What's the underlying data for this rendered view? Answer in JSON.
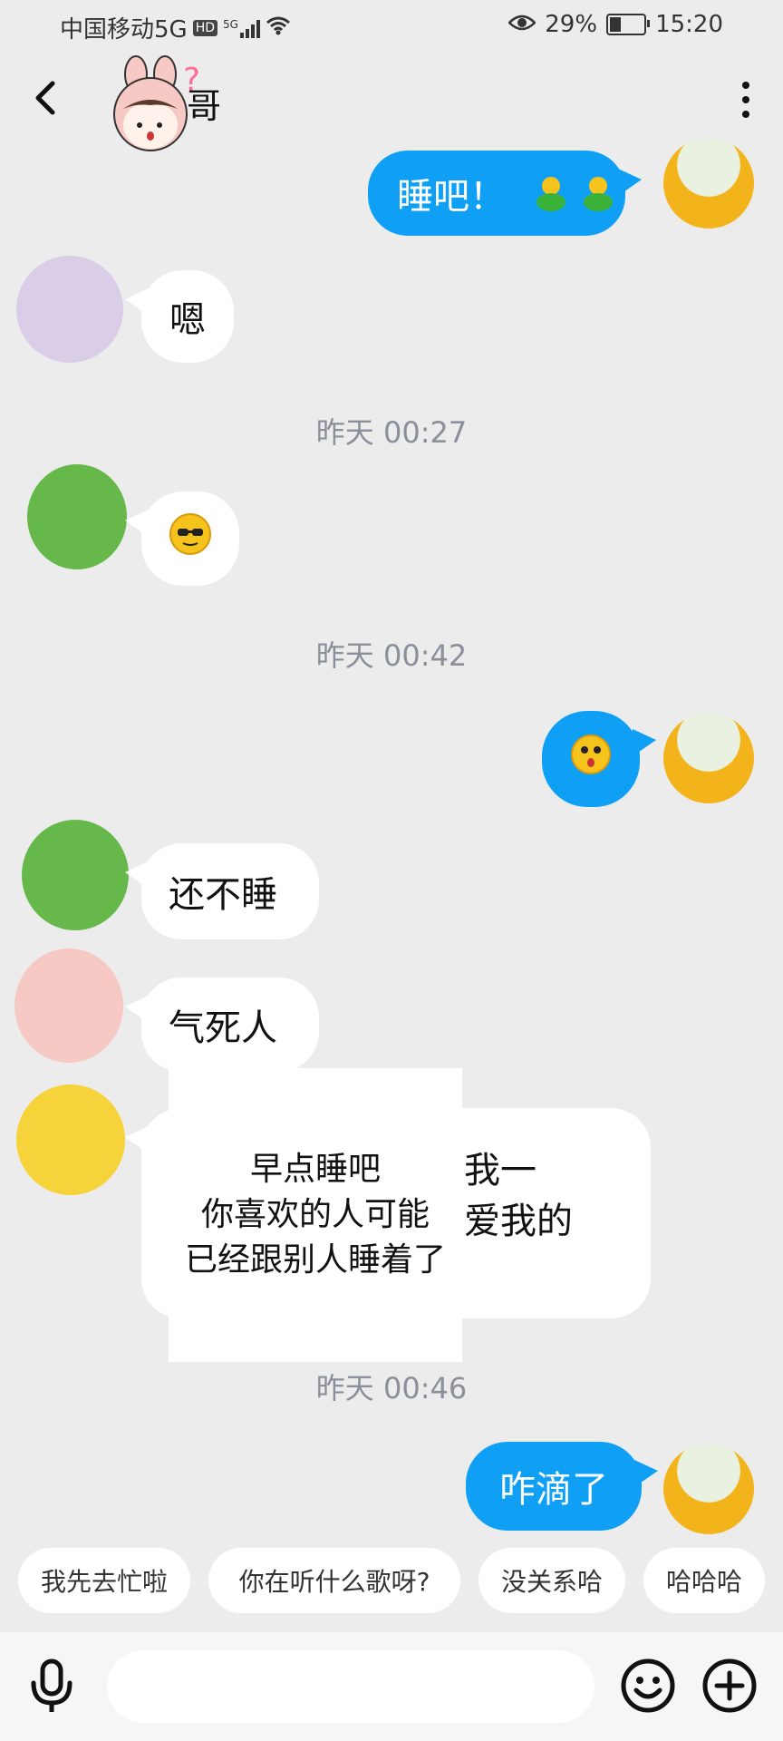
{
  "status": {
    "carrier": "中国移动5G",
    "hd": "HD",
    "net": "5G",
    "battery": "29%",
    "time": "15:20"
  },
  "header": {
    "title_fragment": "哥"
  },
  "messages": [
    {
      "text": "睡吧！"
    },
    {
      "text": "嗯"
    },
    {
      "time": "昨天 00:27"
    },
    {
      "time": "昨天 00:42"
    },
    {
      "text": "还不睡"
    },
    {
      "text": "气死人"
    },
    {
      "partial": "我一",
      "partial2": "爱我的"
    },
    {
      "time": "昨天 00:46"
    },
    {
      "text": "咋滴了"
    }
  ],
  "sticker": {
    "line1": "早点睡吧",
    "line2": "你喜欢的人可能",
    "line3": "已经跟别人睡着了"
  },
  "quick_replies": [
    "我先去忙啦",
    "你在听什么歌呀?",
    "没关系哈",
    "哈哈哈"
  ],
  "input": {
    "placeholder": ""
  },
  "colors": {
    "out_bubble": "#0fa0f5",
    "background": "#ececec"
  }
}
